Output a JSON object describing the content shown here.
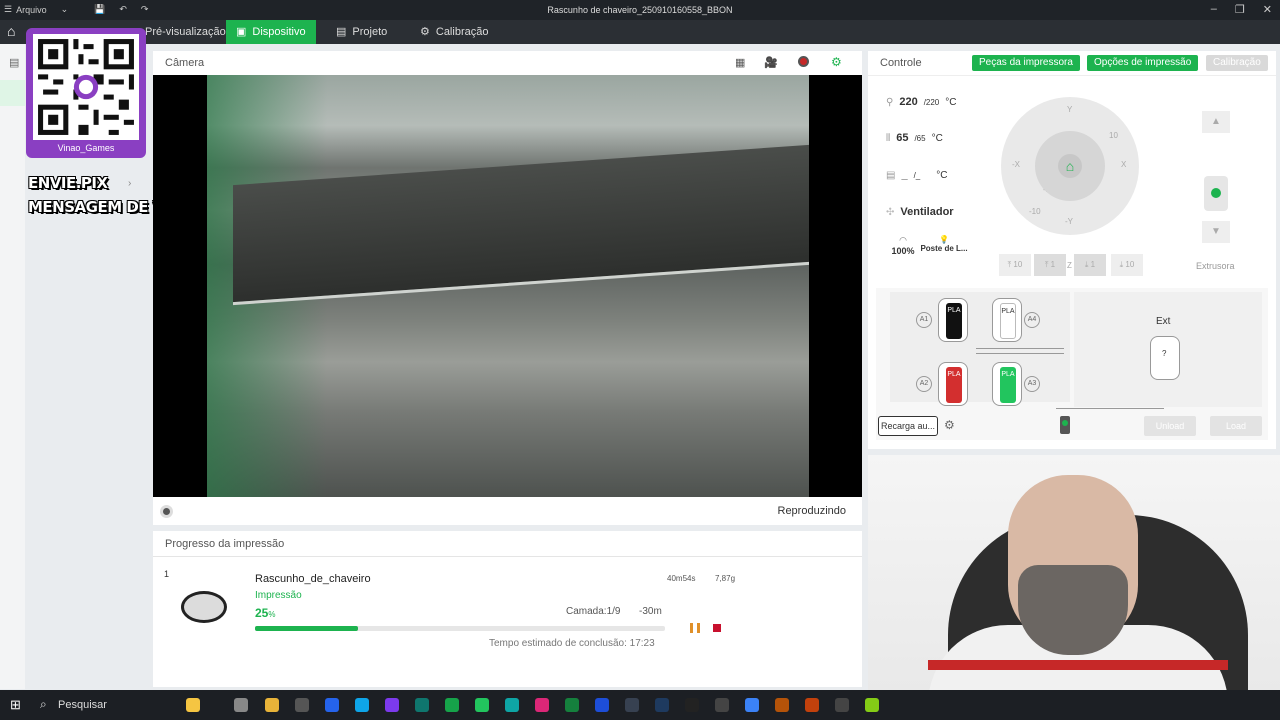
{
  "window": {
    "menu_label": "Arquivo",
    "title": "Rascunho de chaveiro_250910160558_BBON"
  },
  "tabs": [
    {
      "label": "Pré-visualização"
    },
    {
      "label": "Dispositivo"
    },
    {
      "label": "Projeto"
    },
    {
      "label": "Calibração"
    }
  ],
  "stream_overlay": {
    "qr_caption": "Vinao_Games",
    "line1": "ENVIE.PIX",
    "line2": "MENSAGEM DE VOZ"
  },
  "camera": {
    "title": "Câmera",
    "status": "Reproduzindo"
  },
  "progress": {
    "title": "Progresso da impressão",
    "plate_number": "1",
    "job_name": "Rascunho_de_chaveiro",
    "state": "Impressão",
    "percent_value": "25",
    "percent_unit": "%",
    "percent_fraction": 0.25,
    "time_used": "40m54s",
    "weight": "7,87g",
    "layer": "Camada:1/9",
    "remaining": "-30m",
    "eta": "Tempo estimado de conclusão: 17:23"
  },
  "control": {
    "title": "Controle",
    "btn_parts": "Peças da impressora",
    "btn_options": "Opções de impressão",
    "btn_calibration": "Calibração",
    "nozzle_temp": "220",
    "nozzle_target": "/220",
    "bed_temp": "65",
    "bed_target": "/65",
    "chamber_temp": "_",
    "chamber_target": "/_",
    "unit": "°C",
    "fan_label": "Ventilador",
    "speed": "100%",
    "light_label": "Poste de L...",
    "jog": {
      "y_top": "Y",
      "y_bottom": "-Y",
      "x_left": "-X",
      "x_right": "X",
      "p10": "10",
      "p1": "1",
      "m1": "-1",
      "m10": "-10"
    },
    "z_buttons": [
      "10",
      "1",
      "1",
      "10"
    ],
    "z_label": "Z",
    "extruder_label": "Extrusora",
    "ams": {
      "slots": [
        {
          "slot": "A1",
          "material": "PLA",
          "color": "#111111"
        },
        {
          "slot": "A4",
          "material": "PLA",
          "color": "#ffffff"
        },
        {
          "slot": "A2",
          "material": "PLA",
          "color": "#d32f2f"
        },
        {
          "slot": "A3",
          "material": "PLA",
          "color": "#22c55e"
        }
      ],
      "ext_label": "Ext",
      "ext_unknown": "?"
    },
    "btn_reload": "Recarga au...",
    "btn_unload": "Unload",
    "btn_load": "Load"
  },
  "taskbar": {
    "search_label": "Pesquisar"
  },
  "colors": {
    "accent": "#1db34f",
    "stop": "#c8102e",
    "pause": "#e0902a"
  }
}
